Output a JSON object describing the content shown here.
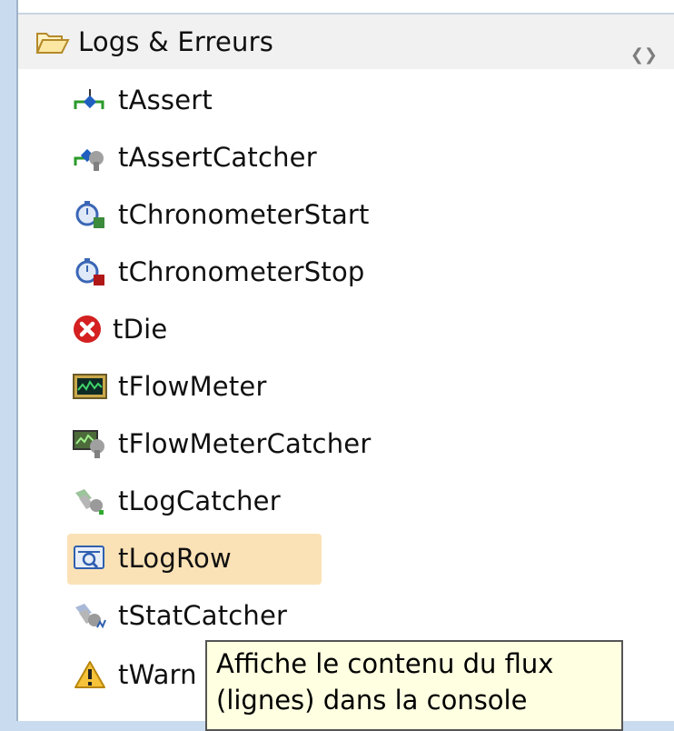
{
  "palette": {
    "header_label": "Logs & Erreurs",
    "items": [
      {
        "label": "tAssert",
        "icon": "assert-icon"
      },
      {
        "label": "tAssertCatcher",
        "icon": "assert-catcher-icon"
      },
      {
        "label": "tChronometerStart",
        "icon": "chronometer-start-icon"
      },
      {
        "label": "tChronometerStop",
        "icon": "chronometer-stop-icon"
      },
      {
        "label": "tDie",
        "icon": "die-icon"
      },
      {
        "label": "tFlowMeter",
        "icon": "flow-meter-icon"
      },
      {
        "label": "tFlowMeterCatcher",
        "icon": "flow-meter-catcher-icon"
      },
      {
        "label": "tLogCatcher",
        "icon": "log-catcher-icon"
      },
      {
        "label": "tLogRow",
        "icon": "log-row-icon",
        "selected": true
      },
      {
        "label": "tStatCatcher",
        "icon": "stat-catcher-icon"
      },
      {
        "label": "tWarn",
        "icon": "warning-icon"
      }
    ]
  },
  "tooltip": {
    "line1": "Affiche le contenu du flux",
    "line2": "(lignes) dans la console"
  },
  "colors": {
    "selection": "#fbe2b6",
    "tooltip_bg": "#ffffe1",
    "header_bg": "#f1f1f1"
  }
}
